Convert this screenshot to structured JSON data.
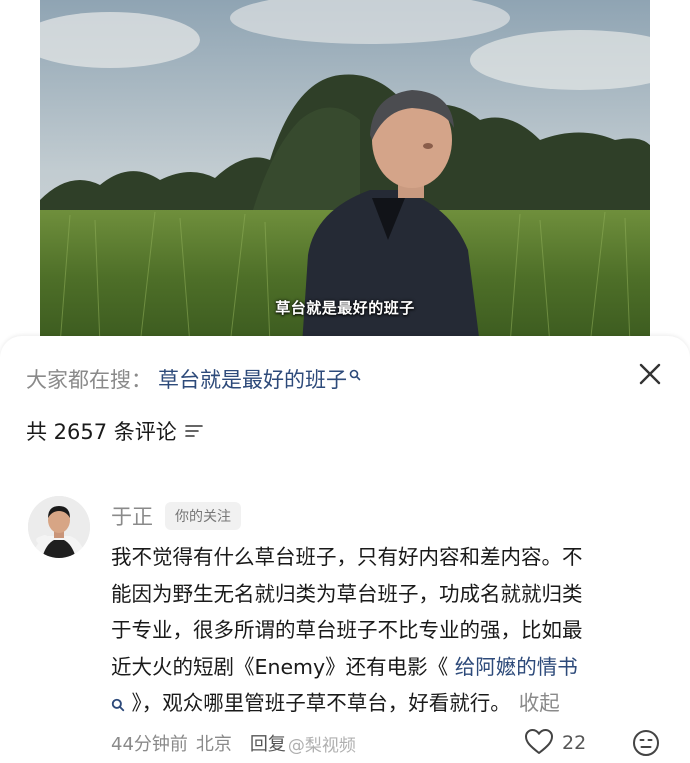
{
  "video": {
    "subtitle": "草台就是最好的班子"
  },
  "sheet": {
    "search_prefix": "大家都在搜：",
    "search_term": "草台就是最好的班子",
    "comment_count_text": "共 2657 条评论"
  },
  "comment": {
    "username": "于正",
    "follow_badge": "你的关注",
    "lines": [
      "我不觉得有什么草台班子，只有好内容和差内容。不",
      "能因为野生无名就归类为草台班子，功成名就就归类",
      "于专业，很多所谓的草台班子不比专业的强，比如最"
    ],
    "line4_text": "近大火的短剧《Enemy》还有电影《",
    "line4_link": "给阿嬷的情书",
    "line5_text": "》，观众哪里管班子草不草台，好看就行。",
    "collapse_label": "收起",
    "time_ago": "44分钟前",
    "location": "北京",
    "reply_label": "回复",
    "watermark": "@梨视频",
    "like_count": "22"
  },
  "icons": {
    "search_mini": "search-icon",
    "close": "close-icon",
    "filter": "filter-icon",
    "like": "heart-icon",
    "emoji": "emoji-icon"
  },
  "colors": {
    "link": "#2d4a7a",
    "muted": "#8a8a8a",
    "text": "#1a1a1a",
    "badge_bg": "#f1f1f1"
  }
}
